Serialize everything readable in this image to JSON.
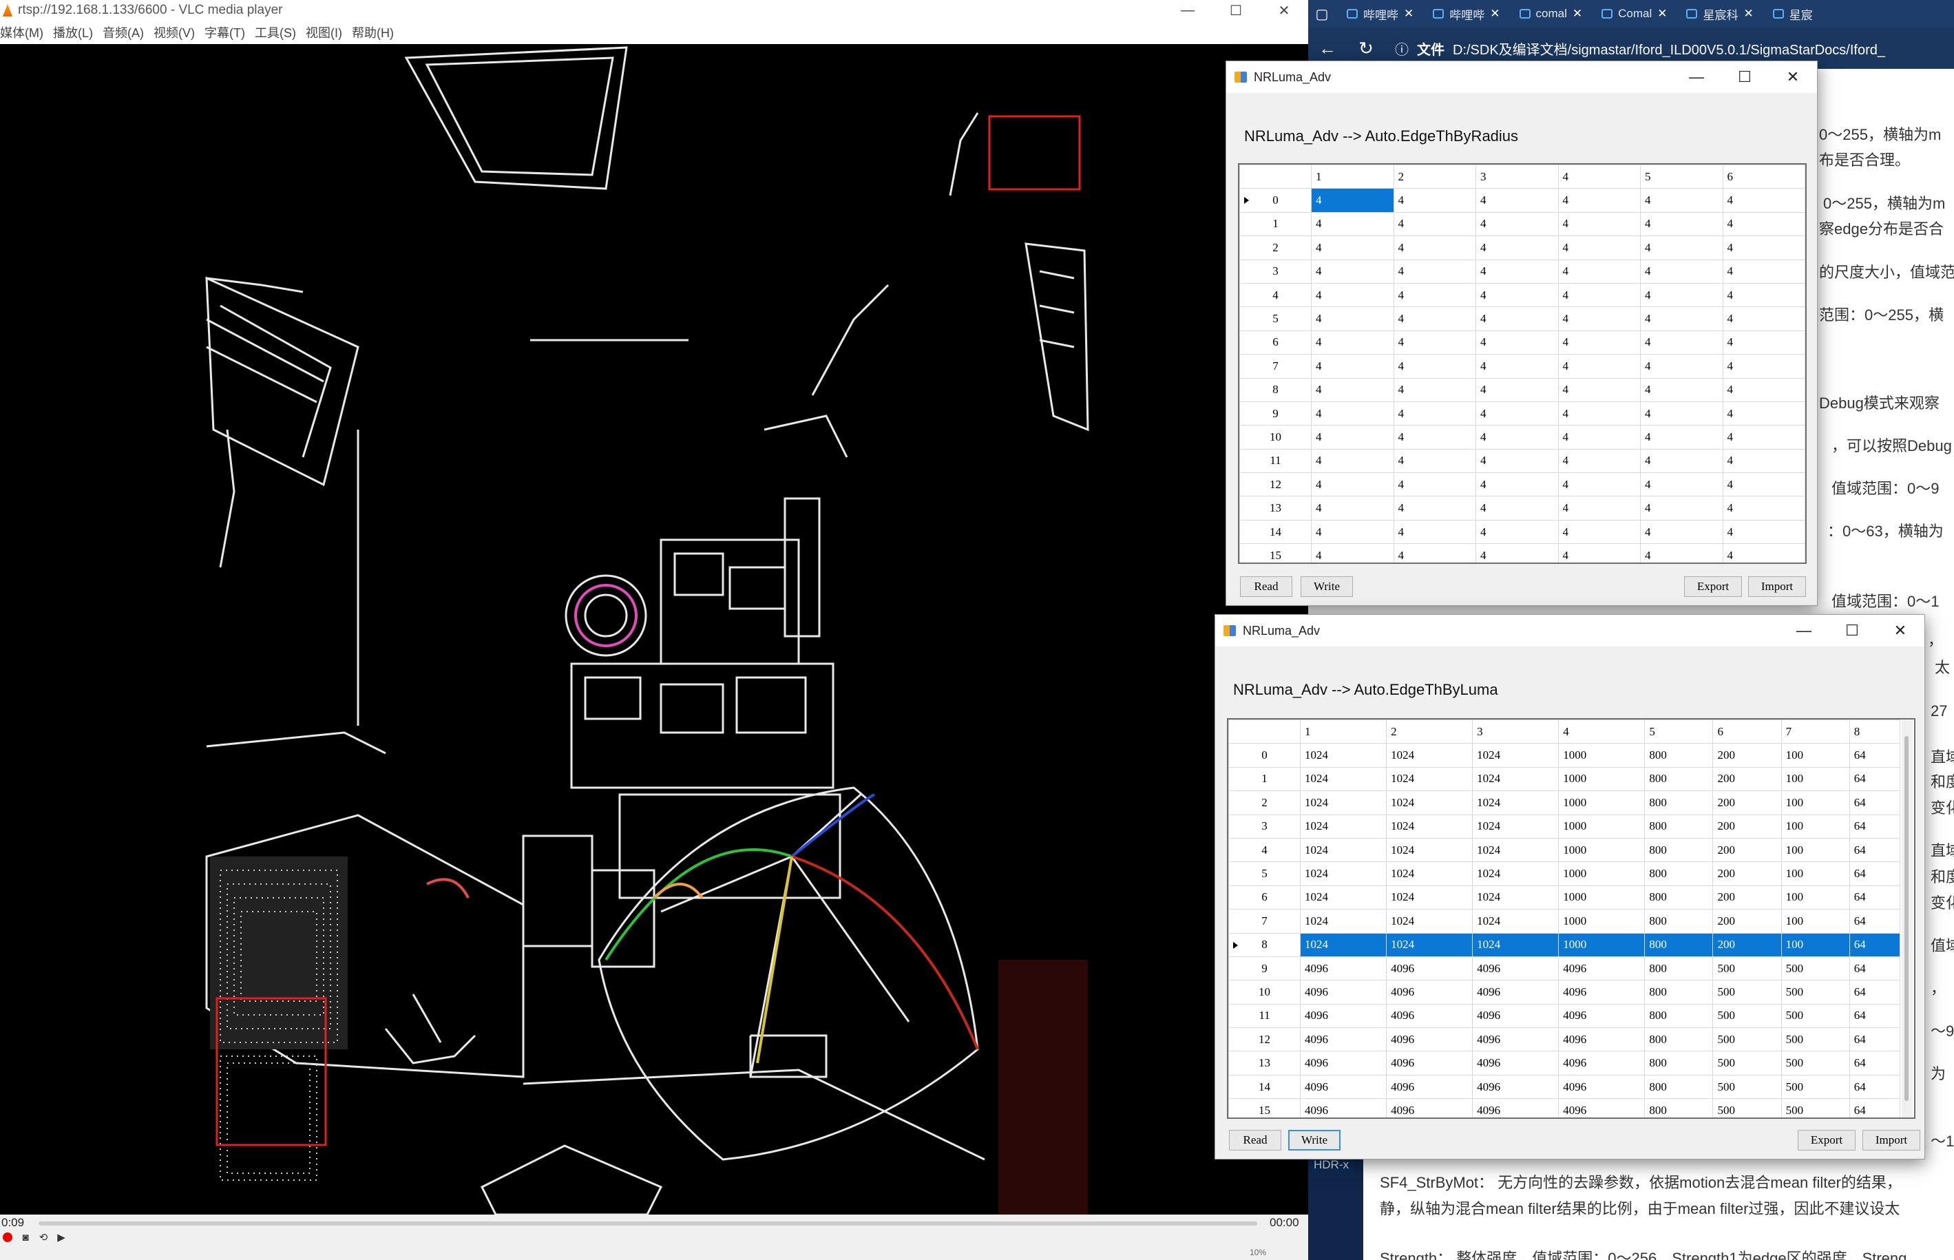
{
  "vlc": {
    "title": "rtsp://192.168.1.133/6600 - VLC media player",
    "menu": [
      "媒体(M)",
      "播放(L)",
      "音频(A)",
      "视频(V)",
      "字幕(T)",
      "工具(S)",
      "视图(I)",
      "帮助(H)"
    ],
    "time_elapsed": "0:09",
    "time_total": "00:00",
    "volume": "10%"
  },
  "browser": {
    "tabs": [
      "哔哩哔",
      "哔哩哔",
      "comal",
      "Comal",
      "星宸科",
      "星宸"
    ],
    "address_label": "文件",
    "address": "D:/SDK及编译文档/sigmastar/Iford_ILD00V5.0.1/SigmaStarDocs/Iford_",
    "page_lines": [
      "0～255，横轴为m",
      "布是否合理。",
      "0～255，横轴为m",
      "察edge分布是否合",
      "的尺度大小，值域范",
      "范围：0～255，横",
      "Debug模式来观察",
      "，可以按照Debug",
      "值域范围：0～9",
      "：0～63，横轴为",
      "值域范围：0～1",
      "，",
      "太",
      "27",
      "直域",
      "和度",
      "变化",
      "直域",
      "和度",
      "变化",
      "值域",
      "，",
      "～9",
      "为",
      "～1",
      "SF4_StrByMot：  无方向性的去躁参数，依据motion去混合mean filter的结果，",
      "静，纵轴为混合mean filter结果的比例，由于mean filter过强，因此不建议设太",
      "Strength：  整体强度，值域范围：0～256，Strength1为edge区的强度，Streng"
    ],
    "hdr_chip": "HDR-x"
  },
  "dialog1": {
    "title": "NRLuma_Adv",
    "heading": "NRLuma_Adv --> Auto.EdgeThByRadius",
    "columns": [
      "1",
      "2",
      "3",
      "4",
      "5",
      "6"
    ],
    "rows": [
      [
        "0",
        "4",
        "4",
        "4",
        "4",
        "4",
        "4"
      ],
      [
        "1",
        "4",
        "4",
        "4",
        "4",
        "4",
        "4"
      ],
      [
        "2",
        "4",
        "4",
        "4",
        "4",
        "4",
        "4"
      ],
      [
        "3",
        "4",
        "4",
        "4",
        "4",
        "4",
        "4"
      ],
      [
        "4",
        "4",
        "4",
        "4",
        "4",
        "4",
        "4"
      ],
      [
        "5",
        "4",
        "4",
        "4",
        "4",
        "4",
        "4"
      ],
      [
        "6",
        "4",
        "4",
        "4",
        "4",
        "4",
        "4"
      ],
      [
        "7",
        "4",
        "4",
        "4",
        "4",
        "4",
        "4"
      ],
      [
        "8",
        "4",
        "4",
        "4",
        "4",
        "4",
        "4"
      ],
      [
        "9",
        "4",
        "4",
        "4",
        "4",
        "4",
        "4"
      ],
      [
        "10",
        "4",
        "4",
        "4",
        "4",
        "4",
        "4"
      ],
      [
        "11",
        "4",
        "4",
        "4",
        "4",
        "4",
        "4"
      ],
      [
        "12",
        "4",
        "4",
        "4",
        "4",
        "4",
        "4"
      ],
      [
        "13",
        "4",
        "4",
        "4",
        "4",
        "4",
        "4"
      ],
      [
        "14",
        "4",
        "4",
        "4",
        "4",
        "4",
        "4"
      ],
      [
        "15",
        "4",
        "4",
        "4",
        "4",
        "4",
        "4"
      ]
    ],
    "current_row": 0,
    "buttons": {
      "read": "Read",
      "write": "Write",
      "export": "Export",
      "import": "Import"
    }
  },
  "dialog2": {
    "title": "NRLuma_Adv",
    "heading": "NRLuma_Adv --> Auto.EdgeThByLuma",
    "columns": [
      "1",
      "2",
      "3",
      "4",
      "5",
      "6",
      "7",
      "8"
    ],
    "rows": [
      [
        "0",
        "1024",
        "1024",
        "1024",
        "1000",
        "800",
        "200",
        "100",
        "64"
      ],
      [
        "1",
        "1024",
        "1024",
        "1024",
        "1000",
        "800",
        "200",
        "100",
        "64"
      ],
      [
        "2",
        "1024",
        "1024",
        "1024",
        "1000",
        "800",
        "200",
        "100",
        "64"
      ],
      [
        "3",
        "1024",
        "1024",
        "1024",
        "1000",
        "800",
        "200",
        "100",
        "64"
      ],
      [
        "4",
        "1024",
        "1024",
        "1024",
        "1000",
        "800",
        "200",
        "100",
        "64"
      ],
      [
        "5",
        "1024",
        "1024",
        "1024",
        "1000",
        "800",
        "200",
        "100",
        "64"
      ],
      [
        "6",
        "1024",
        "1024",
        "1024",
        "1000",
        "800",
        "200",
        "100",
        "64"
      ],
      [
        "7",
        "1024",
        "1024",
        "1024",
        "1000",
        "800",
        "200",
        "100",
        "64"
      ],
      [
        "8",
        "1024",
        "1024",
        "1024",
        "1000",
        "800",
        "200",
        "100",
        "64"
      ],
      [
        "9",
        "4096",
        "4096",
        "4096",
        "4096",
        "800",
        "500",
        "500",
        "64"
      ],
      [
        "10",
        "4096",
        "4096",
        "4096",
        "4096",
        "800",
        "500",
        "500",
        "64"
      ],
      [
        "11",
        "4096",
        "4096",
        "4096",
        "4096",
        "800",
        "500",
        "500",
        "64"
      ],
      [
        "12",
        "4096",
        "4096",
        "4096",
        "4096",
        "800",
        "500",
        "500",
        "64"
      ],
      [
        "13",
        "4096",
        "4096",
        "4096",
        "4096",
        "800",
        "500",
        "500",
        "64"
      ],
      [
        "14",
        "4096",
        "4096",
        "4096",
        "4096",
        "800",
        "500",
        "500",
        "64"
      ],
      [
        "15",
        "4096",
        "4096",
        "4096",
        "4096",
        "800",
        "500",
        "500",
        "64"
      ]
    ],
    "selected_row": 8,
    "buttons": {
      "read": "Read",
      "write": "Write",
      "export": "Export",
      "import": "Import"
    }
  },
  "colors": {
    "selection": "#0a78d4",
    "vlc_record": "#e00000",
    "roi_box": "#e02020",
    "browser_chrome": "#1f3d6b"
  }
}
